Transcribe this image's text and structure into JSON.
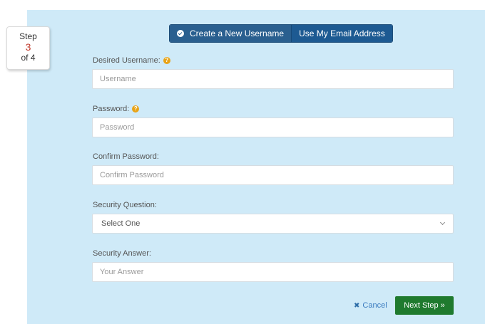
{
  "step": {
    "prefix": "Step",
    "current": "3",
    "suffix": "of 4"
  },
  "toggle": {
    "create_label": "Create a New Username",
    "email_label": "Use My Email Address"
  },
  "form": {
    "username": {
      "label": "Desired Username:",
      "placeholder": "Username"
    },
    "password": {
      "label": "Password:",
      "placeholder": "Password"
    },
    "confirm": {
      "label": "Confirm Password:",
      "placeholder": "Confirm Password"
    },
    "question": {
      "label": "Security Question:",
      "selected": "Select One"
    },
    "answer": {
      "label": "Security Answer:",
      "placeholder": "Your Answer"
    }
  },
  "actions": {
    "cancel_label": "Cancel",
    "next_label": "Next Step"
  },
  "icons": {
    "help": "?",
    "check": "check-circle-icon",
    "cancel": "x-icon",
    "next": "double-chevron-right-icon",
    "select": "chevron-down-icon"
  },
  "colors": {
    "panel": "#cfeaf8",
    "toggle": "#2a5f8f",
    "next": "#1f7a2e",
    "help": "#e8a317",
    "step_number": "#c0392b"
  }
}
